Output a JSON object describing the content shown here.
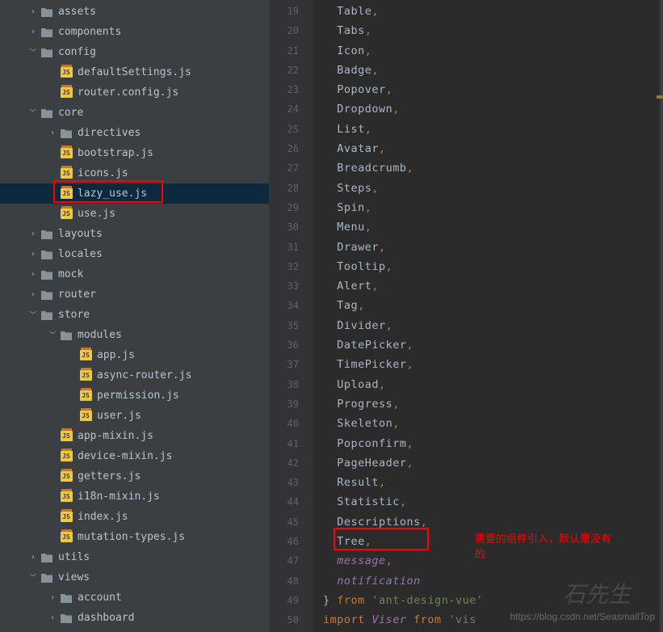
{
  "tree": [
    {
      "indent": 1,
      "chevron": "right",
      "type": "folder",
      "label": "assets"
    },
    {
      "indent": 1,
      "chevron": "right",
      "type": "folder",
      "label": "components"
    },
    {
      "indent": 1,
      "chevron": "down",
      "type": "folder",
      "label": "config"
    },
    {
      "indent": 2,
      "chevron": "",
      "type": "js",
      "label": "defaultSettings.js"
    },
    {
      "indent": 2,
      "chevron": "",
      "type": "js",
      "label": "router.config.js"
    },
    {
      "indent": 1,
      "chevron": "down",
      "type": "folder",
      "label": "core"
    },
    {
      "indent": 2,
      "chevron": "right",
      "type": "folder",
      "label": "directives"
    },
    {
      "indent": 2,
      "chevron": "",
      "type": "js",
      "label": "bootstrap.js"
    },
    {
      "indent": 2,
      "chevron": "",
      "type": "js",
      "label": "icons.js"
    },
    {
      "indent": 2,
      "chevron": "",
      "type": "js",
      "label": "lazy_use.js",
      "selected": true,
      "highlight": true
    },
    {
      "indent": 2,
      "chevron": "",
      "type": "js",
      "label": "use.js"
    },
    {
      "indent": 1,
      "chevron": "right",
      "type": "folder",
      "label": "layouts"
    },
    {
      "indent": 1,
      "chevron": "right",
      "type": "folder",
      "label": "locales"
    },
    {
      "indent": 1,
      "chevron": "right",
      "type": "folder",
      "label": "mock"
    },
    {
      "indent": 1,
      "chevron": "right",
      "type": "folder",
      "label": "router"
    },
    {
      "indent": 1,
      "chevron": "down",
      "type": "folder",
      "label": "store"
    },
    {
      "indent": 2,
      "chevron": "down",
      "type": "folder",
      "label": "modules"
    },
    {
      "indent": 3,
      "chevron": "",
      "type": "js",
      "label": "app.js"
    },
    {
      "indent": 3,
      "chevron": "",
      "type": "js",
      "label": "async-router.js"
    },
    {
      "indent": 3,
      "chevron": "",
      "type": "js",
      "label": "permission.js"
    },
    {
      "indent": 3,
      "chevron": "",
      "type": "js",
      "label": "user.js"
    },
    {
      "indent": 2,
      "chevron": "",
      "type": "js",
      "label": "app-mixin.js"
    },
    {
      "indent": 2,
      "chevron": "",
      "type": "js",
      "label": "device-mixin.js"
    },
    {
      "indent": 2,
      "chevron": "",
      "type": "js",
      "label": "getters.js"
    },
    {
      "indent": 2,
      "chevron": "",
      "type": "js",
      "label": "i18n-mixin.js"
    },
    {
      "indent": 2,
      "chevron": "",
      "type": "js",
      "label": "index.js"
    },
    {
      "indent": 2,
      "chevron": "",
      "type": "js",
      "label": "mutation-types.js"
    },
    {
      "indent": 1,
      "chevron": "right",
      "type": "folder",
      "label": "utils"
    },
    {
      "indent": 1,
      "chevron": "down",
      "type": "folder",
      "label": "views"
    },
    {
      "indent": 2,
      "chevron": "right",
      "type": "folder",
      "label": "account"
    },
    {
      "indent": 2,
      "chevron": "right",
      "type": "folder",
      "label": "dashboard"
    }
  ],
  "gutter_start": 19,
  "gutter_end": 50,
  "code_lines": [
    {
      "tokens": [
        {
          "t": "  Table",
          "c": "ident"
        },
        {
          "t": ",",
          "c": "comma"
        }
      ]
    },
    {
      "tokens": [
        {
          "t": "  Tabs",
          "c": "ident"
        },
        {
          "t": ",",
          "c": "comma"
        }
      ]
    },
    {
      "tokens": [
        {
          "t": "  Icon",
          "c": "ident"
        },
        {
          "t": ",",
          "c": "comma"
        }
      ]
    },
    {
      "tokens": [
        {
          "t": "  Badge",
          "c": "ident"
        },
        {
          "t": ",",
          "c": "comma"
        }
      ]
    },
    {
      "tokens": [
        {
          "t": "  Popover",
          "c": "ident"
        },
        {
          "t": ",",
          "c": "comma"
        }
      ]
    },
    {
      "tokens": [
        {
          "t": "  Dropdown",
          "c": "ident"
        },
        {
          "t": ",",
          "c": "comma"
        }
      ]
    },
    {
      "tokens": [
        {
          "t": "  List",
          "c": "ident"
        },
        {
          "t": ",",
          "c": "comma"
        }
      ]
    },
    {
      "tokens": [
        {
          "t": "  Avatar",
          "c": "ident"
        },
        {
          "t": ",",
          "c": "comma"
        }
      ]
    },
    {
      "tokens": [
        {
          "t": "  Breadcrumb",
          "c": "ident"
        },
        {
          "t": ",",
          "c": "comma"
        }
      ]
    },
    {
      "tokens": [
        {
          "t": "  Steps",
          "c": "ident"
        },
        {
          "t": ",",
          "c": "comma"
        }
      ]
    },
    {
      "tokens": [
        {
          "t": "  Spin",
          "c": "ident"
        },
        {
          "t": ",",
          "c": "comma"
        }
      ]
    },
    {
      "tokens": [
        {
          "t": "  Menu",
          "c": "ident"
        },
        {
          "t": ",",
          "c": "comma"
        }
      ]
    },
    {
      "tokens": [
        {
          "t": "  Drawer",
          "c": "ident"
        },
        {
          "t": ",",
          "c": "comma"
        }
      ]
    },
    {
      "tokens": [
        {
          "t": "  Tooltip",
          "c": "ident"
        },
        {
          "t": ",",
          "c": "comma"
        }
      ]
    },
    {
      "tokens": [
        {
          "t": "  Alert",
          "c": "ident"
        },
        {
          "t": ",",
          "c": "comma"
        }
      ]
    },
    {
      "tokens": [
        {
          "t": "  Tag",
          "c": "ident"
        },
        {
          "t": ",",
          "c": "comma"
        }
      ]
    },
    {
      "tokens": [
        {
          "t": "  Divider",
          "c": "ident"
        },
        {
          "t": ",",
          "c": "comma"
        }
      ]
    },
    {
      "tokens": [
        {
          "t": "  DatePicker",
          "c": "ident"
        },
        {
          "t": ",",
          "c": "comma"
        }
      ]
    },
    {
      "tokens": [
        {
          "t": "  TimePicker",
          "c": "ident"
        },
        {
          "t": ",",
          "c": "comma"
        }
      ]
    },
    {
      "tokens": [
        {
          "t": "  Upload",
          "c": "ident"
        },
        {
          "t": ",",
          "c": "comma"
        }
      ]
    },
    {
      "tokens": [
        {
          "t": "  Progress",
          "c": "ident"
        },
        {
          "t": ",",
          "c": "comma"
        }
      ]
    },
    {
      "tokens": [
        {
          "t": "  Skeleton",
          "c": "ident"
        },
        {
          "t": ",",
          "c": "comma"
        }
      ]
    },
    {
      "tokens": [
        {
          "t": "  Popconfirm",
          "c": "ident"
        },
        {
          "t": ",",
          "c": "comma"
        }
      ]
    },
    {
      "tokens": [
        {
          "t": "  PageHeader",
          "c": "ident"
        },
        {
          "t": ",",
          "c": "comma"
        }
      ]
    },
    {
      "tokens": [
        {
          "t": "  Result",
          "c": "ident"
        },
        {
          "t": ",",
          "c": "comma"
        }
      ]
    },
    {
      "tokens": [
        {
          "t": "  Statistic",
          "c": "ident"
        },
        {
          "t": ",",
          "c": "comma"
        }
      ]
    },
    {
      "tokens": [
        {
          "t": "  Descriptions",
          "c": "ident"
        },
        {
          "t": ",",
          "c": "comma"
        }
      ]
    },
    {
      "tokens": [
        {
          "t": "  Tree",
          "c": "ident"
        },
        {
          "t": ",",
          "c": "comma"
        }
      ],
      "highlight": true
    },
    {
      "tokens": [
        {
          "t": "  message",
          "c": "italic"
        },
        {
          "t": ",",
          "c": "comma"
        }
      ]
    },
    {
      "tokens": [
        {
          "t": "  notification",
          "c": "italic"
        }
      ]
    },
    {
      "tokens": [
        {
          "t": "}",
          "c": "brace"
        },
        {
          "t": " from ",
          "c": "kw"
        },
        {
          "t": "'ant-design-vue'",
          "c": "str"
        }
      ]
    },
    {
      "tokens": [
        {
          "t": "import ",
          "c": "kw"
        },
        {
          "t": "Viser",
          "c": "italic"
        },
        {
          "t": " from ",
          "c": "kw"
        },
        {
          "t": "'vis",
          "c": "str"
        }
      ]
    }
  ],
  "annotation": {
    "text1": "需要的组件引入，默认是没有",
    "text2": "的"
  },
  "watermark_url": "https://blog.csdn.net/SeasmallTop",
  "watermark_name": "石先生"
}
